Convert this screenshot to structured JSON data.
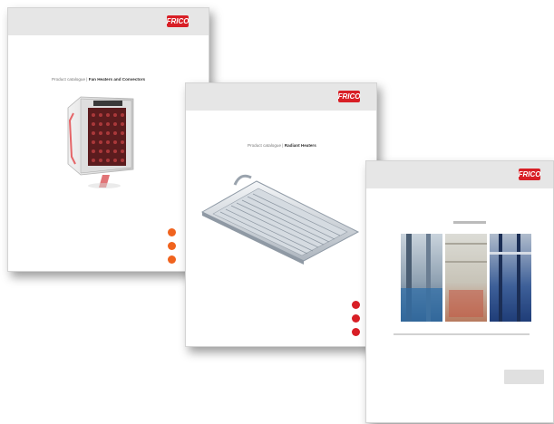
{
  "catalogs": [
    {
      "brand_text": "",
      "logo_text": "FRICO",
      "headline_prefix": "Product catalogue",
      "headline_title": "Fan Heaters and Convectors",
      "dot_color": "#f0631e"
    },
    {
      "brand_text": "",
      "logo_text": "FRICO",
      "headline_prefix": "Product catalogue",
      "headline_title": "Radiant Heaters",
      "dot_color": "#d81f26"
    },
    {
      "brand_text": "",
      "logo_text": "FRICO",
      "headline_prefix": "",
      "headline_title": "",
      "dot_color": "#d81f26"
    }
  ],
  "colors": {
    "brand_red": "#d81f26",
    "brand_orange": "#f0631e",
    "topbar_grey": "#e6e6e6"
  }
}
